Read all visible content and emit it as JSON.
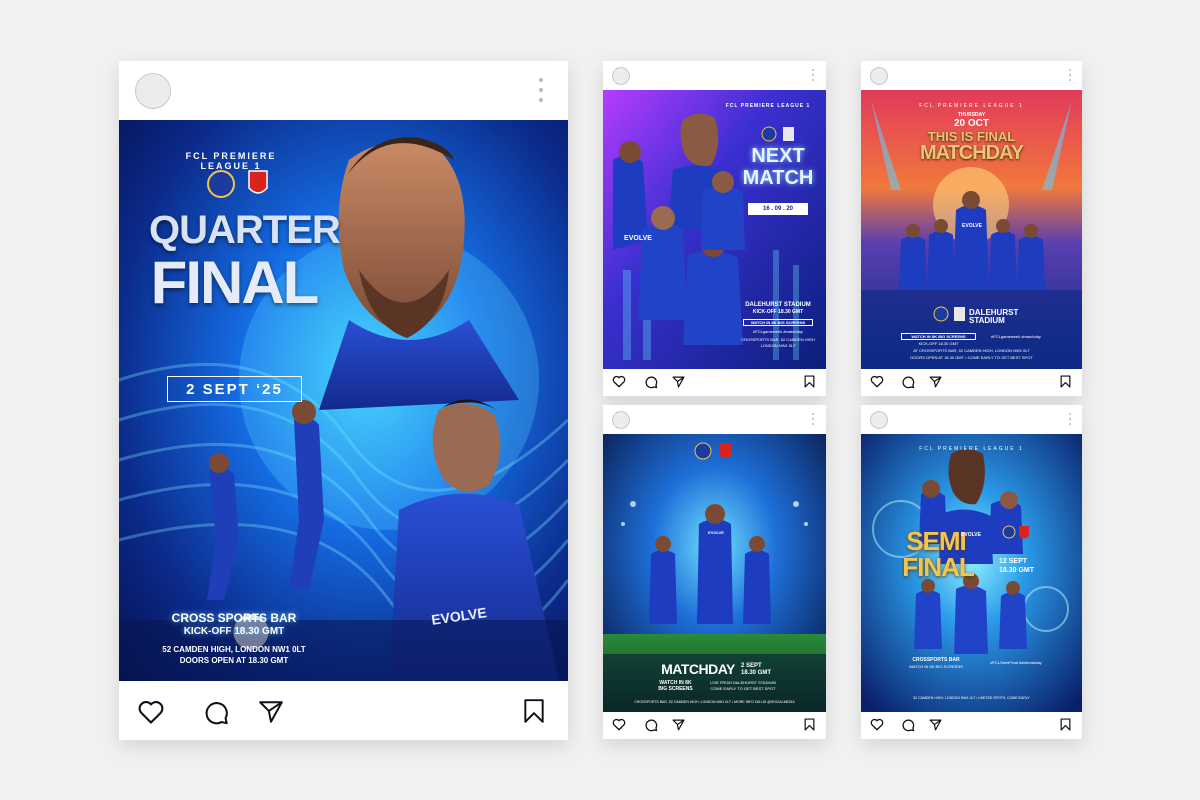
{
  "cards": [
    {
      "id": "large",
      "poster": {
        "league": "FCL PREMIERE LEAGUE 1",
        "title_line1": "QUARTER",
        "title_line2": "FINAL",
        "date": "2 SEPT ‘25",
        "venue": "CROSS SPORTS BAR",
        "kickoff": "KICK-OFF 18.30 GMT",
        "address": "52 CAMDEN HIGH, LONDON NW1 0LT",
        "doors": "DOORS OPEN AT 18.30 GMT",
        "shirt_sponsor": "EVOLVE"
      }
    },
    {
      "id": "next-match",
      "poster": {
        "league": "FCL PREMIERE LEAGUE 1",
        "title_line1": "NEXT",
        "title_line2": "MATCH",
        "date": "16 . 09 . 20",
        "venue": "DALEHURST STADIUM",
        "kickoff": "KICK-OFF 18.30 GMT",
        "info1": "WATCH IN 8K BIG SCREENS",
        "hashtags": "#FCLgameweek #matchday",
        "address": "CROSSPORTS BAR, 52 CAMDEN HIGH LONDON NW1 0LT",
        "shirt_sponsor": "EVOLVE"
      }
    },
    {
      "id": "final-matchday",
      "poster": {
        "league": "FCL PREMIERE LEAGUE 1",
        "day": "THURSDAY",
        "date": "20 OCT",
        "title_line1": "THIS IS FINAL",
        "title_line2": "MATCHDAY",
        "venue_line1": "DALEHURST",
        "venue_line2": "STADIUM",
        "info1": "WATCH IN 8K BIG SCREENS",
        "hashtags": "#FCLgameweek #matchday",
        "kickoff": "KICK-OFF 18.30 GMT",
        "address": "AT CROSSPORTS BAR, 52 CAMDEN HIGH, LONDON NW1 0LT",
        "doors": "DOORS OPEN AT 18.30 GMT • COME EARLY TO GET BEST SPOT",
        "shirt_sponsor": "EVOLVE"
      }
    },
    {
      "id": "matchday",
      "poster": {
        "title": "MATCHDAY",
        "date": "2 SEPT",
        "time": "18.30 GMT",
        "info1": "WATCH IN 8K",
        "info2": "BIG SCREENS",
        "live": "LIVE FROM DALEHURST STADIUM",
        "early": "COME EARLY TO GET BEST SPOT",
        "address": "CROSSPORTS BAR, 52 CAMDEN HIGH, LONDON NW1 0LT • MORE INFO DM US @SOCIALMEDIA",
        "shirt_sponsor": "EVOLVE"
      }
    },
    {
      "id": "semi-final",
      "poster": {
        "league": "FCL PREMIERE LEAGUE 1",
        "title_line1": "SEMI",
        "title_line2": "FINAL",
        "date": "12 SEPT",
        "time": "18.30 GMT",
        "venue": "CROSSPORTS BAR",
        "info1": "WATCH IN 8K BIG SCREENS",
        "hashtags": "#FCLSemiFinal #sidematday",
        "address": "52 CAMDEN HIGH, LONDON NW1 0LT • LIMITED SPOTS, COME EARLY",
        "shirt_sponsor": "EVOLVE"
      }
    }
  ],
  "icons": {
    "like": "heart-icon",
    "comment": "comment-icon",
    "share": "send-icon",
    "save": "bookmark-icon",
    "menu": "more-vertical-icon"
  },
  "colors": {
    "background": "#f1f1f1",
    "card": "#ffffff",
    "accent_blue": "#1a6bff",
    "deep_navy": "#0a1a5c",
    "cyan_glow": "#37c8ff",
    "gold": "#e8b94a"
  }
}
